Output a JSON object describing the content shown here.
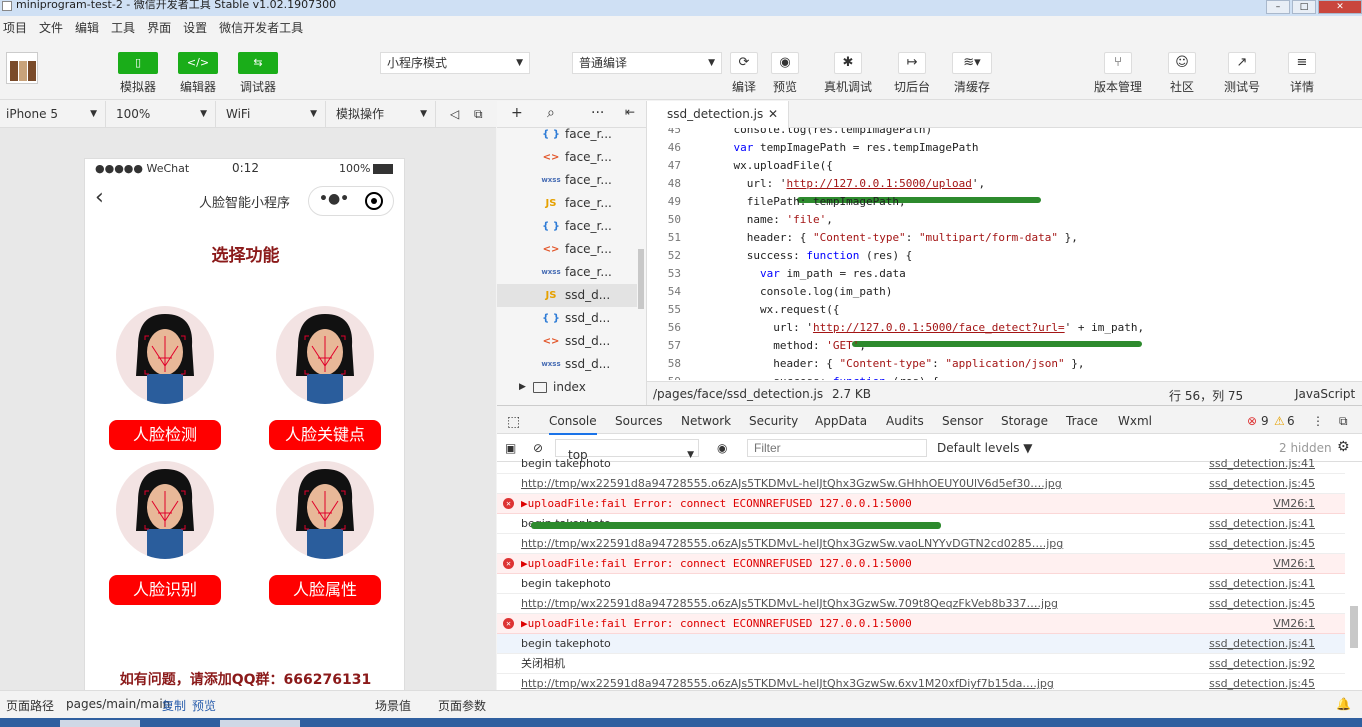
{
  "window": {
    "title": "miniprogram-test-2 - 微信开发者工具 Stable v1.02.1907300"
  },
  "menu": [
    "项目",
    "文件",
    "编辑",
    "工具",
    "界面",
    "设置",
    "微信开发者工具"
  ],
  "toolbar": {
    "simulator": "模拟器",
    "editor": "编辑器",
    "debugger": "调试器",
    "mode": "小程序模式",
    "compile": "普通编译",
    "actions": [
      "编译",
      "预览",
      "真机调试",
      "切后台",
      "清缓存"
    ],
    "right_actions": [
      "版本管理",
      "社区",
      "测试号",
      "详情"
    ]
  },
  "device_bar": {
    "device": "iPhone 5",
    "zoom": "100%",
    "network": "WiFi",
    "operation": "模拟操作"
  },
  "phone": {
    "carrier": "●●●●● WeChat",
    "time": "0:12",
    "battery": "100%",
    "nav_title": "人脸智能小程序",
    "page_title": "选择功能",
    "buttons": [
      "人脸检测",
      "人脸关键点",
      "人脸识别",
      "人脸属性"
    ],
    "contact": "如有问题，请添加QQ群：666276131"
  },
  "file_tree": {
    "items": [
      {
        "icon": "{ }",
        "name": "face_r..."
      },
      {
        "icon": "<>",
        "name": "face_r..."
      },
      {
        "icon": "wxss",
        "name": "face_r..."
      },
      {
        "icon": "JS",
        "name": "face_r..."
      },
      {
        "icon": "{ }",
        "name": "face_r..."
      },
      {
        "icon": "<>",
        "name": "face_r..."
      },
      {
        "icon": "wxss",
        "name": "face_r..."
      },
      {
        "icon": "JS",
        "name": "ssd_d..."
      },
      {
        "icon": "{ }",
        "name": "ssd_d..."
      },
      {
        "icon": "<>",
        "name": "ssd_d..."
      },
      {
        "icon": "wxss",
        "name": "ssd_d..."
      }
    ],
    "folder": "index"
  },
  "editor": {
    "tab": "ssd_detection.js",
    "lines": [
      {
        "n": "45",
        "t": "    console.log(res.tempImagePath)"
      },
      {
        "n": "46",
        "t": "    var tempImagePath = res.tempImagePath"
      },
      {
        "n": "47",
        "t": "    wx.uploadFile({"
      },
      {
        "n": "48",
        "t": "      url: 'http://127.0.0.1:5000/upload',"
      },
      {
        "n": "49",
        "t": "      filePath: tempImagePath,"
      },
      {
        "n": "50",
        "t": "      name: 'file',"
      },
      {
        "n": "51",
        "t": "      header: { \"Content-type\": \"multipart/form-data\" },"
      },
      {
        "n": "52",
        "t": "      success: function (res) {"
      },
      {
        "n": "53",
        "t": "        var im_path = res.data"
      },
      {
        "n": "54",
        "t": "        console.log(im_path)"
      },
      {
        "n": "55",
        "t": "        wx.request({"
      },
      {
        "n": "56",
        "t": "          url: 'http://127.0.0.1:5000/face_detect?url=' + im_path,"
      },
      {
        "n": "57",
        "t": "          method: 'GET',"
      },
      {
        "n": "58",
        "t": "          header: { \"Content-type\": \"application/json\" },"
      },
      {
        "n": "59",
        "t": "          success: function (res) {"
      }
    ],
    "status": {
      "path": "/pages/face/ssd_detection.js",
      "size": "2.7 KB",
      "position": "行 56，列 75",
      "language": "JavaScript"
    }
  },
  "devtools": {
    "tabs": [
      "Console",
      "Sources",
      "Network",
      "Security",
      "AppData",
      "Audits",
      "Sensor",
      "Storage",
      "Trace",
      "Wxml"
    ],
    "errors": "9",
    "warnings": "6",
    "context": "top",
    "filter_placeholder": "Filter",
    "levels": "Default levels ▼",
    "hidden": "2 hidden",
    "logs": [
      {
        "type": "log",
        "msg": "begin takephoto",
        "src": "ssd_detection.js:41"
      },
      {
        "type": "link",
        "msg": "http://tmp/wx22591d8a94728555.o6zAJs5TKDMvL-heIJtQhx3GzwSw.GHhhOEUY0UlV6d5ef30….jpg",
        "src": "ssd_detection.js:45"
      },
      {
        "type": "err",
        "msg": "▶uploadFile:fail Error: connect ECONNREFUSED 127.0.0.1:5000",
        "src": "VM26:1"
      },
      {
        "type": "log",
        "msg": "begin takephoto",
        "src": "ssd_detection.js:41"
      },
      {
        "type": "link",
        "msg": "http://tmp/wx22591d8a94728555.o6zAJs5TKDMvL-heIJtQhx3GzwSw.vaoLNYYvDGTN2cd0285….jpg",
        "src": "ssd_detection.js:45"
      },
      {
        "type": "err",
        "msg": "▶uploadFile:fail Error: connect ECONNREFUSED 127.0.0.1:5000",
        "src": "VM26:1"
      },
      {
        "type": "log",
        "msg": "begin takephoto",
        "src": "ssd_detection.js:41"
      },
      {
        "type": "link",
        "msg": "http://tmp/wx22591d8a94728555.o6zAJs5TKDMvL-heIJtQhx3GzwSw.709t8QeqzFkVeb8b337….jpg",
        "src": "ssd_detection.js:45"
      },
      {
        "type": "err",
        "msg": "▶uploadFile:fail Error: connect ECONNREFUSED 127.0.0.1:5000",
        "src": "VM26:1"
      },
      {
        "type": "hl",
        "msg": "begin takephoto",
        "src": "ssd_detection.js:41"
      },
      {
        "type": "log",
        "msg": "关闭相机",
        "src": "ssd_detection.js:92"
      },
      {
        "type": "link",
        "msg": "http://tmp/wx22591d8a94728555.o6zAJs5TKDMvL-heIJtQhx3GzwSw.6xv1M20xfDiyf7b15da….jpg",
        "src": "ssd_detection.js:45"
      }
    ]
  },
  "bottom": {
    "label": "页面路径",
    "path": "pages/main/main",
    "copy": "复制",
    "preview": "预览",
    "scene": "场景值",
    "params": "页面参数"
  }
}
